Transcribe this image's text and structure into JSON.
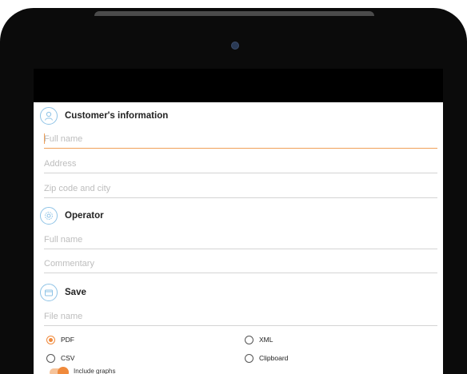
{
  "customer": {
    "title": "Customer's information",
    "fullname_placeholder": "Full name",
    "address_placeholder": "Address",
    "zip_placeholder": "Zip code and city"
  },
  "operator": {
    "title": "Operator",
    "fullname_placeholder": "Full name",
    "commentary_placeholder": "Commentary"
  },
  "save": {
    "title": "Save",
    "filename_placeholder": "File name",
    "formats": [
      {
        "label": "PDF",
        "selected": true
      },
      {
        "label": "XML",
        "selected": false
      },
      {
        "label": "CSV",
        "selected": false
      },
      {
        "label": "Clipboard",
        "selected": false
      }
    ],
    "toggle_label": "Include graphs",
    "toggle_on": true
  },
  "colors": {
    "accent": "#f08a3c",
    "section_icon": "#8ec3e6",
    "device": "#0b0b0b"
  }
}
